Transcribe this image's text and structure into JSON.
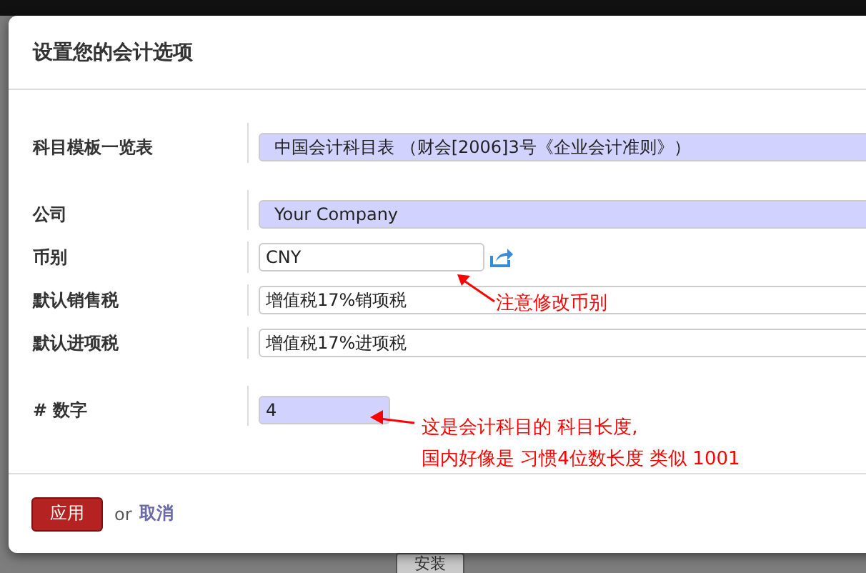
{
  "background": {
    "buttons": [
      "安装"
    ]
  },
  "dialog": {
    "title": "设置您的会计选项",
    "sections": [
      {
        "fields": [
          {
            "label": "科目模板一览表",
            "value": "中国会计科目表 （财会[2006]3号《企业会计准则》）",
            "kind": "select",
            "required": true
          }
        ]
      },
      {
        "fields": [
          {
            "label": "公司",
            "value": "Your Company",
            "kind": "select",
            "required": true
          },
          {
            "label": "币别",
            "value": "CNY",
            "kind": "link",
            "required": false
          },
          {
            "label": "默认销售税",
            "value": "增值税17%销项税",
            "kind": "select",
            "required": false
          },
          {
            "label": "默认进项税",
            "value": "增值税17%进项税",
            "kind": "select",
            "required": false
          }
        ]
      },
      {
        "fields": [
          {
            "label": "# 数字",
            "value": "4",
            "kind": "number",
            "required": true
          }
        ]
      }
    ],
    "footer": {
      "apply": "应用",
      "or": "or",
      "cancel": "取消"
    }
  },
  "annotations": [
    {
      "lines": [
        "注意修改币别"
      ]
    },
    {
      "lines": [
        "这是会计科目的 科目长度,",
        "国内好像是 习惯4位数长度 类似 1001"
      ]
    }
  ]
}
